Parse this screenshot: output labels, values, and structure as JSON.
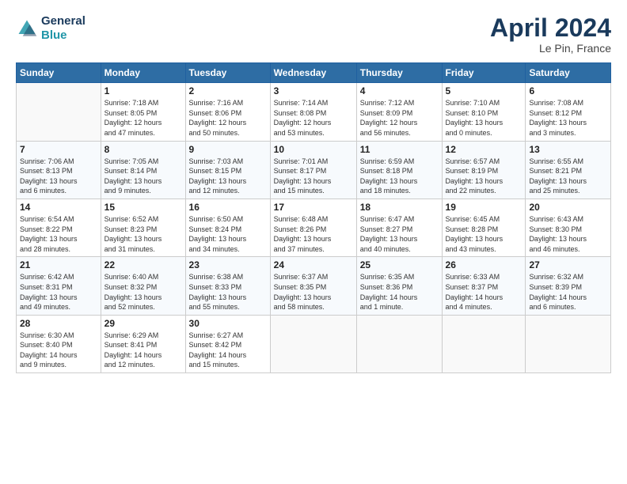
{
  "header": {
    "logo_line1": "General",
    "logo_line2": "Blue",
    "month_title": "April 2024",
    "location": "Le Pin, France"
  },
  "weekdays": [
    "Sunday",
    "Monday",
    "Tuesday",
    "Wednesday",
    "Thursday",
    "Friday",
    "Saturday"
  ],
  "weeks": [
    [
      {
        "day": "",
        "info": ""
      },
      {
        "day": "1",
        "info": "Sunrise: 7:18 AM\nSunset: 8:05 PM\nDaylight: 12 hours\nand 47 minutes."
      },
      {
        "day": "2",
        "info": "Sunrise: 7:16 AM\nSunset: 8:06 PM\nDaylight: 12 hours\nand 50 minutes."
      },
      {
        "day": "3",
        "info": "Sunrise: 7:14 AM\nSunset: 8:08 PM\nDaylight: 12 hours\nand 53 minutes."
      },
      {
        "day": "4",
        "info": "Sunrise: 7:12 AM\nSunset: 8:09 PM\nDaylight: 12 hours\nand 56 minutes."
      },
      {
        "day": "5",
        "info": "Sunrise: 7:10 AM\nSunset: 8:10 PM\nDaylight: 13 hours\nand 0 minutes."
      },
      {
        "day": "6",
        "info": "Sunrise: 7:08 AM\nSunset: 8:12 PM\nDaylight: 13 hours\nand 3 minutes."
      }
    ],
    [
      {
        "day": "7",
        "info": "Sunrise: 7:06 AM\nSunset: 8:13 PM\nDaylight: 13 hours\nand 6 minutes."
      },
      {
        "day": "8",
        "info": "Sunrise: 7:05 AM\nSunset: 8:14 PM\nDaylight: 13 hours\nand 9 minutes."
      },
      {
        "day": "9",
        "info": "Sunrise: 7:03 AM\nSunset: 8:15 PM\nDaylight: 13 hours\nand 12 minutes."
      },
      {
        "day": "10",
        "info": "Sunrise: 7:01 AM\nSunset: 8:17 PM\nDaylight: 13 hours\nand 15 minutes."
      },
      {
        "day": "11",
        "info": "Sunrise: 6:59 AM\nSunset: 8:18 PM\nDaylight: 13 hours\nand 18 minutes."
      },
      {
        "day": "12",
        "info": "Sunrise: 6:57 AM\nSunset: 8:19 PM\nDaylight: 13 hours\nand 22 minutes."
      },
      {
        "day": "13",
        "info": "Sunrise: 6:55 AM\nSunset: 8:21 PM\nDaylight: 13 hours\nand 25 minutes."
      }
    ],
    [
      {
        "day": "14",
        "info": "Sunrise: 6:54 AM\nSunset: 8:22 PM\nDaylight: 13 hours\nand 28 minutes."
      },
      {
        "day": "15",
        "info": "Sunrise: 6:52 AM\nSunset: 8:23 PM\nDaylight: 13 hours\nand 31 minutes."
      },
      {
        "day": "16",
        "info": "Sunrise: 6:50 AM\nSunset: 8:24 PM\nDaylight: 13 hours\nand 34 minutes."
      },
      {
        "day": "17",
        "info": "Sunrise: 6:48 AM\nSunset: 8:26 PM\nDaylight: 13 hours\nand 37 minutes."
      },
      {
        "day": "18",
        "info": "Sunrise: 6:47 AM\nSunset: 8:27 PM\nDaylight: 13 hours\nand 40 minutes."
      },
      {
        "day": "19",
        "info": "Sunrise: 6:45 AM\nSunset: 8:28 PM\nDaylight: 13 hours\nand 43 minutes."
      },
      {
        "day": "20",
        "info": "Sunrise: 6:43 AM\nSunset: 8:30 PM\nDaylight: 13 hours\nand 46 minutes."
      }
    ],
    [
      {
        "day": "21",
        "info": "Sunrise: 6:42 AM\nSunset: 8:31 PM\nDaylight: 13 hours\nand 49 minutes."
      },
      {
        "day": "22",
        "info": "Sunrise: 6:40 AM\nSunset: 8:32 PM\nDaylight: 13 hours\nand 52 minutes."
      },
      {
        "day": "23",
        "info": "Sunrise: 6:38 AM\nSunset: 8:33 PM\nDaylight: 13 hours\nand 55 minutes."
      },
      {
        "day": "24",
        "info": "Sunrise: 6:37 AM\nSunset: 8:35 PM\nDaylight: 13 hours\nand 58 minutes."
      },
      {
        "day": "25",
        "info": "Sunrise: 6:35 AM\nSunset: 8:36 PM\nDaylight: 14 hours\nand 1 minute."
      },
      {
        "day": "26",
        "info": "Sunrise: 6:33 AM\nSunset: 8:37 PM\nDaylight: 14 hours\nand 4 minutes."
      },
      {
        "day": "27",
        "info": "Sunrise: 6:32 AM\nSunset: 8:39 PM\nDaylight: 14 hours\nand 6 minutes."
      }
    ],
    [
      {
        "day": "28",
        "info": "Sunrise: 6:30 AM\nSunset: 8:40 PM\nDaylight: 14 hours\nand 9 minutes."
      },
      {
        "day": "29",
        "info": "Sunrise: 6:29 AM\nSunset: 8:41 PM\nDaylight: 14 hours\nand 12 minutes."
      },
      {
        "day": "30",
        "info": "Sunrise: 6:27 AM\nSunset: 8:42 PM\nDaylight: 14 hours\nand 15 minutes."
      },
      {
        "day": "",
        "info": ""
      },
      {
        "day": "",
        "info": ""
      },
      {
        "day": "",
        "info": ""
      },
      {
        "day": "",
        "info": ""
      }
    ]
  ]
}
